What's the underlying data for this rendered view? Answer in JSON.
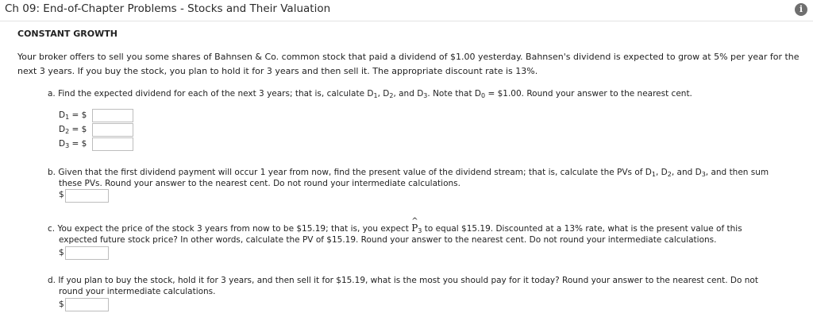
{
  "header": {
    "title": "Ch 09: End-of-Chapter Problems - Stocks and Their Valuation",
    "info_icon": "info-icon"
  },
  "section": {
    "title": "CONSTANT GROWTH"
  },
  "intro": {
    "line1": "Your broker offers to sell you some shares of Bahnsen & Co. common stock that paid a dividend of $1.00 yesterday. Bahnsen's dividend is expected to grow at 5% per year for the",
    "line2": "next 3 years. If you buy the stock, you plan to hold it for 3 years and then sell it. The appropriate discount rate is 13%."
  },
  "part_a": {
    "text_pre": "a. Find the expected dividend for each of the next 3 years; that is, calculate D",
    "text_mid1": ", D",
    "text_mid2": ", and D",
    "text_mid3": ". Note that D",
    "text_post": " = $1.00. Round your answer to the nearest cent.",
    "sub1": "1",
    "sub2": "2",
    "sub3": "3",
    "sub0": "0",
    "rows": [
      {
        "label": "D",
        "sub": "1",
        "eq": "= $",
        "value": ""
      },
      {
        "label": "D",
        "sub": "2",
        "eq": "= $",
        "value": ""
      },
      {
        "label": "D",
        "sub": "3",
        "eq": "= $",
        "value": ""
      }
    ]
  },
  "part_b": {
    "line1_pre": "b. Given that the first dividend payment will occur 1 year from now, find the present value of the dividend stream; that is, calculate the PVs of D",
    "line1_mid1": ", D",
    "line1_mid2": ", and D",
    "line1_post": ", and then sum",
    "line2": "these PVs. Round your answer to the nearest cent. Do not round your intermediate calculations.",
    "sub1": "1",
    "sub2": "2",
    "sub3": "3",
    "dollar": "$",
    "value": ""
  },
  "part_c": {
    "line1_pre": "c. You expect the price of the stock 3 years from now to be $15.19; that is, you expect ",
    "p_letter": "P",
    "p_hat": "^",
    "p_sub": "3",
    "line1_post": " to equal $15.19. Discounted at a 13% rate, what is the present value of this",
    "line2": "expected future stock price? In other words, calculate the PV of $15.19. Round your answer to the nearest cent. Do not round your intermediate calculations.",
    "dollar": "$",
    "value": ""
  },
  "part_d": {
    "line1": "d. If you plan to buy the stock, hold it for 3 years, and then sell it for $15.19, what is the most you should pay for it today? Round your answer to the nearest cent. Do not",
    "line2": "round your intermediate calculations.",
    "dollar": "$",
    "value": ""
  }
}
